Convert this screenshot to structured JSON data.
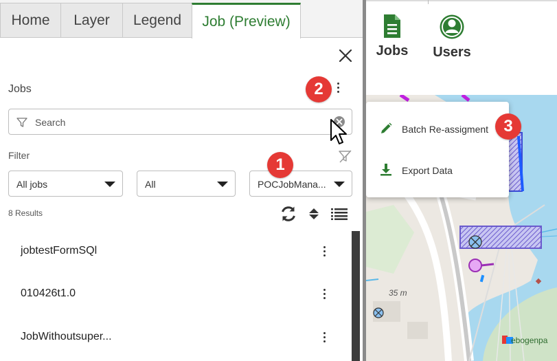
{
  "tabs": [
    {
      "label": "Home",
      "active": false
    },
    {
      "label": "Layer",
      "active": false
    },
    {
      "label": "Legend",
      "active": false
    },
    {
      "label": "Job (Preview)",
      "active": true
    }
  ],
  "panel": {
    "title": "Jobs",
    "search": {
      "placeholder": "Search",
      "value": ""
    },
    "filter_label": "Filter",
    "dropdowns": [
      "All jobs",
      "All",
      "POCJobMana..."
    ],
    "results_text": "8 Results",
    "jobs": [
      "jobtestFormSQl",
      "010426t1.0",
      "JobWithoutsuper..."
    ]
  },
  "badges": [
    "1",
    "2",
    "3"
  ],
  "app_buttons": [
    {
      "label": "Jobs",
      "icon": "document-icon"
    },
    {
      "label": "Users",
      "icon": "user-icon"
    }
  ],
  "context_menu": [
    {
      "label": "Batch Re-assigment",
      "icon": "pencil-icon"
    },
    {
      "label": "Export Data",
      "icon": "download-icon"
    }
  ],
  "map": {
    "labels": [
      "35 m",
      "ebogenpa"
    ]
  },
  "colors": {
    "accent": "#2e7d32",
    "badge": "#e53935",
    "selection": "#6a5acd",
    "water": "#a8d8ef"
  }
}
